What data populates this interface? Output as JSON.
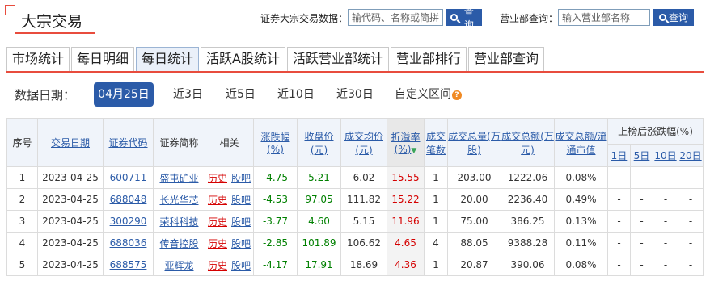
{
  "header": {
    "title": "大宗交易",
    "search_label": "证券大宗交易数据：",
    "search_placeholder": "输代码、名称或简拼",
    "search_btn": "查询",
    "dept_label": "营业部查询：",
    "dept_placeholder": "输入营业部名称",
    "dept_btn": "查询"
  },
  "tabs": [
    "市场统计",
    "每日明细",
    "每日统计",
    "活跃A股统计",
    "活跃营业部统计",
    "营业部排行",
    "营业部查询"
  ],
  "active_tab": "每日统计",
  "filter": {
    "label": "数据日期：",
    "options": [
      "04月25日",
      "近3日",
      "近5日",
      "近10日",
      "近30日",
      "自定义区间"
    ],
    "active": "04月25日"
  },
  "table": {
    "headers": {
      "seq": "序号",
      "date": "交易日期",
      "code": "证券代码",
      "name": "证券简称",
      "related": "相关",
      "change": "涨跌幅(%)",
      "close": "收盘价(元)",
      "avg_price": "成交均价(元)",
      "premium": "折溢率(%)",
      "count": "成交笔数",
      "volume": "成交总量(万股)",
      "amount": "成交总额(万元)",
      "ratio": "成交总额/流通市值",
      "post_change": "上榜后涨跌幅(%)",
      "d1": "1日",
      "d5": "5日",
      "d10": "10日",
      "d20": "20日"
    },
    "related_links": {
      "history": "历史",
      "guba": "股吧"
    },
    "rows": [
      {
        "seq": "1",
        "date": "2023-04-25",
        "code": "600711",
        "name": "盛屯矿业",
        "change": "-4.75",
        "close": "5.21",
        "avg_price": "6.02",
        "premium": "15.55",
        "count": "1",
        "volume": "203.00",
        "amount": "1222.06",
        "ratio": "0.08%",
        "d1": "-",
        "d5": "-",
        "d10": "-",
        "d20": "-"
      },
      {
        "seq": "2",
        "date": "2023-04-25",
        "code": "688048",
        "name": "长光华芯",
        "change": "-4.53",
        "close": "97.05",
        "avg_price": "111.82",
        "premium": "15.22",
        "count": "1",
        "volume": "20.00",
        "amount": "2236.40",
        "ratio": "0.49%",
        "d1": "-",
        "d5": "-",
        "d10": "-",
        "d20": "-"
      },
      {
        "seq": "3",
        "date": "2023-04-25",
        "code": "300290",
        "name": "荣科科技",
        "change": "-3.77",
        "close": "4.60",
        "avg_price": "5.15",
        "premium": "11.96",
        "count": "1",
        "volume": "75.00",
        "amount": "386.25",
        "ratio": "0.13%",
        "d1": "-",
        "d5": "-",
        "d10": "-",
        "d20": "-"
      },
      {
        "seq": "4",
        "date": "2023-04-25",
        "code": "688036",
        "name": "传音控股",
        "change": "-2.85",
        "close": "101.89",
        "avg_price": "106.62",
        "premium": "4.65",
        "count": "4",
        "volume": "88.05",
        "amount": "9388.28",
        "ratio": "0.11%",
        "d1": "-",
        "d5": "-",
        "d10": "-",
        "d20": "-"
      },
      {
        "seq": "5",
        "date": "2023-04-25",
        "code": "688575",
        "name": "亚辉龙",
        "change": "-4.17",
        "close": "17.91",
        "avg_price": "18.69",
        "premium": "4.36",
        "count": "1",
        "volume": "20.87",
        "amount": "390.06",
        "ratio": "0.08%",
        "d1": "-",
        "d5": "-",
        "d10": "-",
        "d20": "-"
      }
    ]
  }
}
